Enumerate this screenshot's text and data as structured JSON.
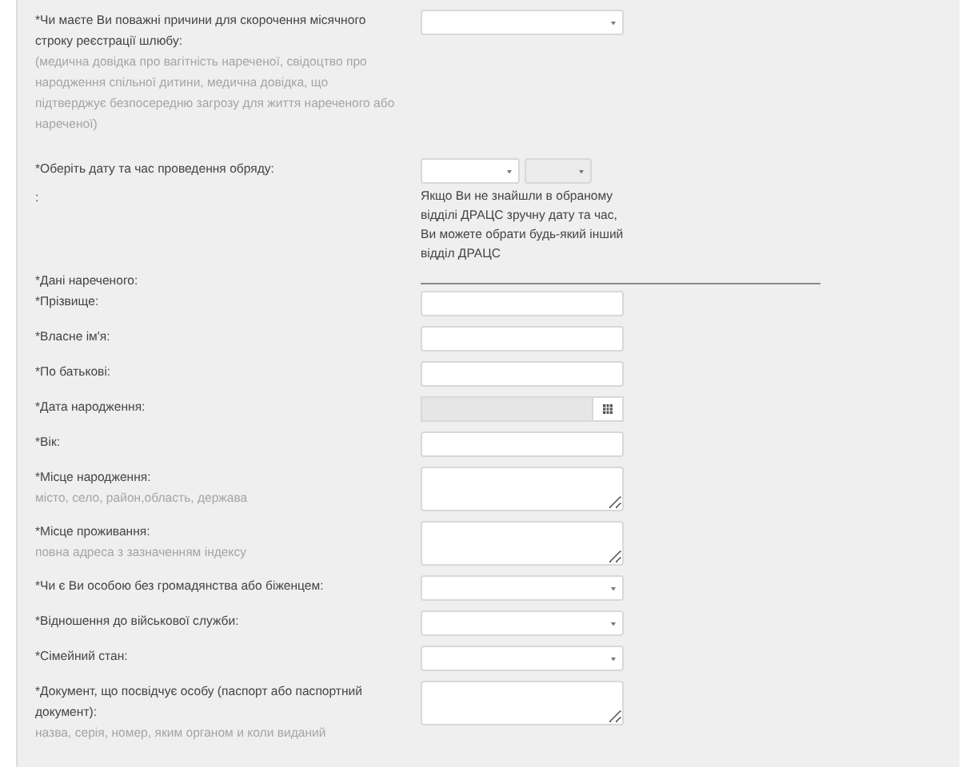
{
  "rows": [
    {
      "kind": "select",
      "label": "*Чи маєте Ви поважні причини для скорочення місячного строку реєстрації шлюбу:",
      "hint": "(медична довідка про вагітність нареченої, свідоцтво про народження спільної дитини, медична довідка, що підтверджує безпосередню загрозу для життя нареченого або нареченої)"
    },
    {
      "kind": "datetime",
      "label": "*Оберіть дату та час проведення обряду:"
    },
    {
      "kind": "note",
      "label": ":",
      "text": "Якщо Ви не знайшли в обраному відділі ДРАЦС зручну дату та час, Ви можете обрати будь-який інший відділ ДРАЦС"
    },
    {
      "kind": "heading",
      "label": "*Дані нареченого:"
    },
    {
      "kind": "text",
      "label": "*Прізвище:"
    },
    {
      "kind": "text",
      "label": "*Власне ім'я:"
    },
    {
      "kind": "text",
      "label": "*По батькові:"
    },
    {
      "kind": "date",
      "label": "*Дата народження:"
    },
    {
      "kind": "text",
      "label": "*Вік:"
    },
    {
      "kind": "textarea",
      "label": "*Місце народження:",
      "hint": "місто, село, район,область, держава"
    },
    {
      "kind": "textarea",
      "label": "*Місце проживання:",
      "hint": "повна адреса з зазначенням індексу"
    },
    {
      "kind": "select",
      "label": "*Чи є Ви особою без громадянства або біженцем:"
    },
    {
      "kind": "select",
      "label": "*Відношення до військової служби:"
    },
    {
      "kind": "select",
      "label": "*Сімейний стан:"
    },
    {
      "kind": "textarea",
      "label": "*Документ, що посвідчує особу (паспорт або паспортний документ):",
      "hint": "назва, серія, номер, яким органом и коли виданий"
    }
  ]
}
